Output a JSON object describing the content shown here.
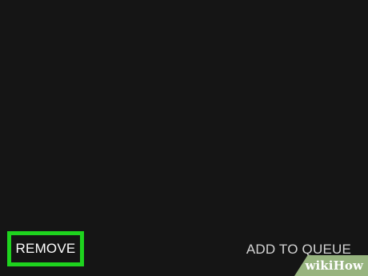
{
  "actions": {
    "remove_label": "REMOVE",
    "add_to_queue_label": "ADD TO QUEUE"
  },
  "watermark": {
    "text": "wikiHow",
    "part_wiki": "wiki",
    "part_how": "How"
  },
  "colors": {
    "background": "#151515",
    "highlight": "#1ed31e",
    "primary_text": "#ffffff",
    "secondary_text": "#d4d4d4",
    "watermark_bg": "#97b47f"
  }
}
